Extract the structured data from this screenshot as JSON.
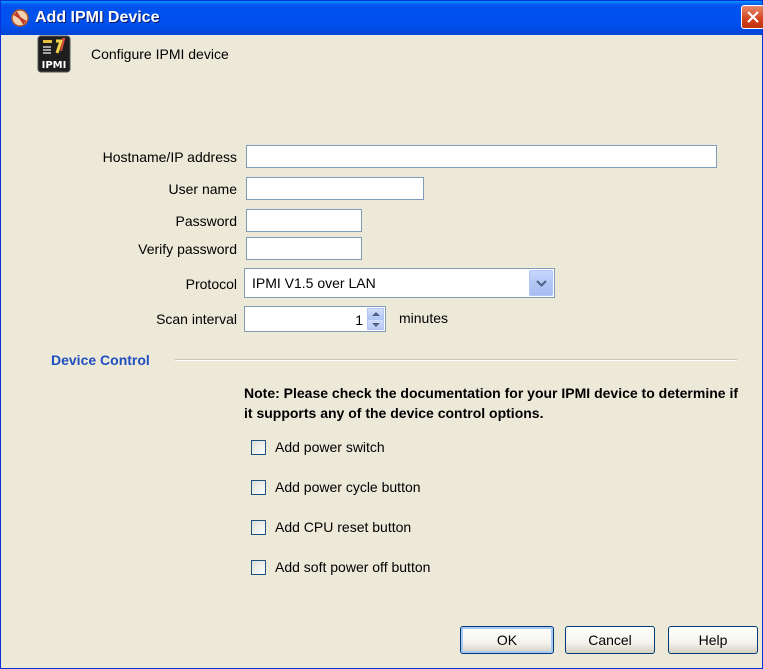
{
  "window": {
    "title": "Add IPMI Device"
  },
  "header": {
    "description": "Configure IPMI device",
    "icon_text": "IPMI"
  },
  "form": {
    "hostname": {
      "label": "Hostname/IP address",
      "value": ""
    },
    "username": {
      "label": "User name",
      "value": ""
    },
    "password": {
      "label": "Password",
      "value": ""
    },
    "verify_password": {
      "label": "Verify password",
      "value": ""
    },
    "protocol": {
      "label": "Protocol",
      "selected": "IPMI V1.5 over LAN"
    },
    "scan_interval": {
      "label": "Scan interval",
      "value": "1",
      "unit": "minutes"
    }
  },
  "device_control": {
    "title": "Device Control",
    "note": "Note: Please check the documentation for your IPMI device to determine if it supports any of the device control options.",
    "options": [
      {
        "label": "Add power switch",
        "checked": false
      },
      {
        "label": "Add power cycle button",
        "checked": false
      },
      {
        "label": "Add CPU reset button",
        "checked": false
      },
      {
        "label": "Add soft power off button",
        "checked": false
      }
    ]
  },
  "buttons": {
    "ok": "OK",
    "cancel": "Cancel",
    "help": "Help"
  },
  "colors": {
    "titlebar": "#0053ee",
    "section_title": "#1f4ec0",
    "dialog_background": "#ece9d8"
  }
}
